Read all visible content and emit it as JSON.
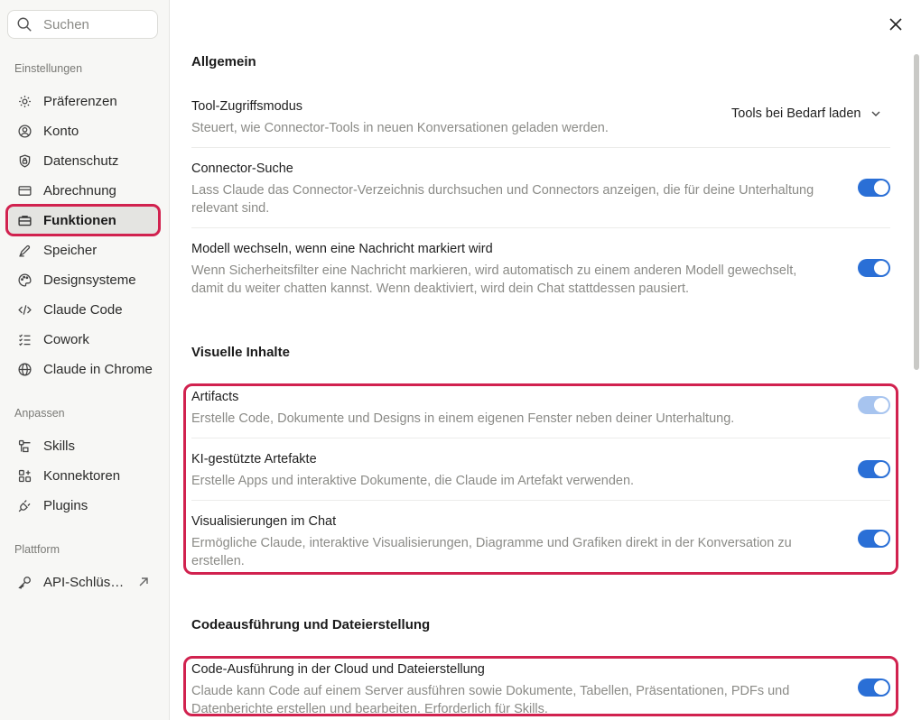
{
  "sidebar": {
    "search_placeholder": "Suchen",
    "section_settings": "Einstellungen",
    "section_customize": "Anpassen",
    "section_platform": "Plattform",
    "items": {
      "preferences": "Präferenzen",
      "account": "Konto",
      "privacy": "Datenschutz",
      "billing": "Abrechnung",
      "features": "Funktionen",
      "memory": "Speicher",
      "design_systems": "Designsysteme",
      "claude_code": "Claude Code",
      "cowork": "Cowork",
      "claude_in_chrome": "Claude in Chrome",
      "skills": "Skills",
      "connectors": "Konnektoren",
      "plugins": "Plugins",
      "api_keys": "API-Schlüs…"
    }
  },
  "main": {
    "general": {
      "heading": "Allgemein",
      "tool_access": {
        "title": "Tool-Zugriffsmodus",
        "desc": "Steuert, wie Connector-Tools in neuen Konversationen geladen werden.",
        "value": "Tools bei Bedarf laden"
      },
      "connector_search": {
        "title": "Connector-Suche",
        "desc": "Lass Claude das Connector-Verzeichnis durchsuchen und Connectors anzeigen, die für deine Unterhaltung relevant sind.",
        "enabled": true
      },
      "switch_model": {
        "title": "Modell wechseln, wenn eine Nachricht markiert wird",
        "desc": "Wenn Sicherheitsfilter eine Nachricht markieren, wird automatisch zu einem anderen Modell gewechselt, damit du weiter chatten kannst. Wenn deaktiviert, wird dein Chat stattdessen pausiert.",
        "enabled": true
      }
    },
    "visual": {
      "heading": "Visuelle Inhalte",
      "artifacts": {
        "title": "Artifacts",
        "desc": "Erstelle Code, Dokumente und Designs in einem eigenen Fenster neben deiner Unterhaltung.",
        "enabled": true,
        "disabled_state": true
      },
      "ai_artifacts": {
        "title": "KI-gestützte Artefakte",
        "desc": "Erstelle Apps und interaktive Dokumente, die Claude im Artefakt verwenden.",
        "enabled": true
      },
      "chat_visuals": {
        "title": "Visualisierungen im Chat",
        "desc": "Ermögliche Claude, interaktive Visualisierungen, Diagramme und Grafiken direkt in der Konversation zu erstellen.",
        "enabled": true
      }
    },
    "code": {
      "heading": "Codeausführung und Dateierstellung",
      "cloud_exec": {
        "title": "Code-Ausführung in der Cloud und Dateierstellung",
        "desc": "Claude kann Code auf einem Server ausführen sowie Dokumente, Tabellen, Präsentationen, PDFs und Datenberichte erstellen und bearbeiten. Erforderlich für Skills.",
        "enabled": true
      }
    }
  },
  "colors": {
    "accent": "#2a6fd6",
    "highlight": "#d1224f"
  }
}
